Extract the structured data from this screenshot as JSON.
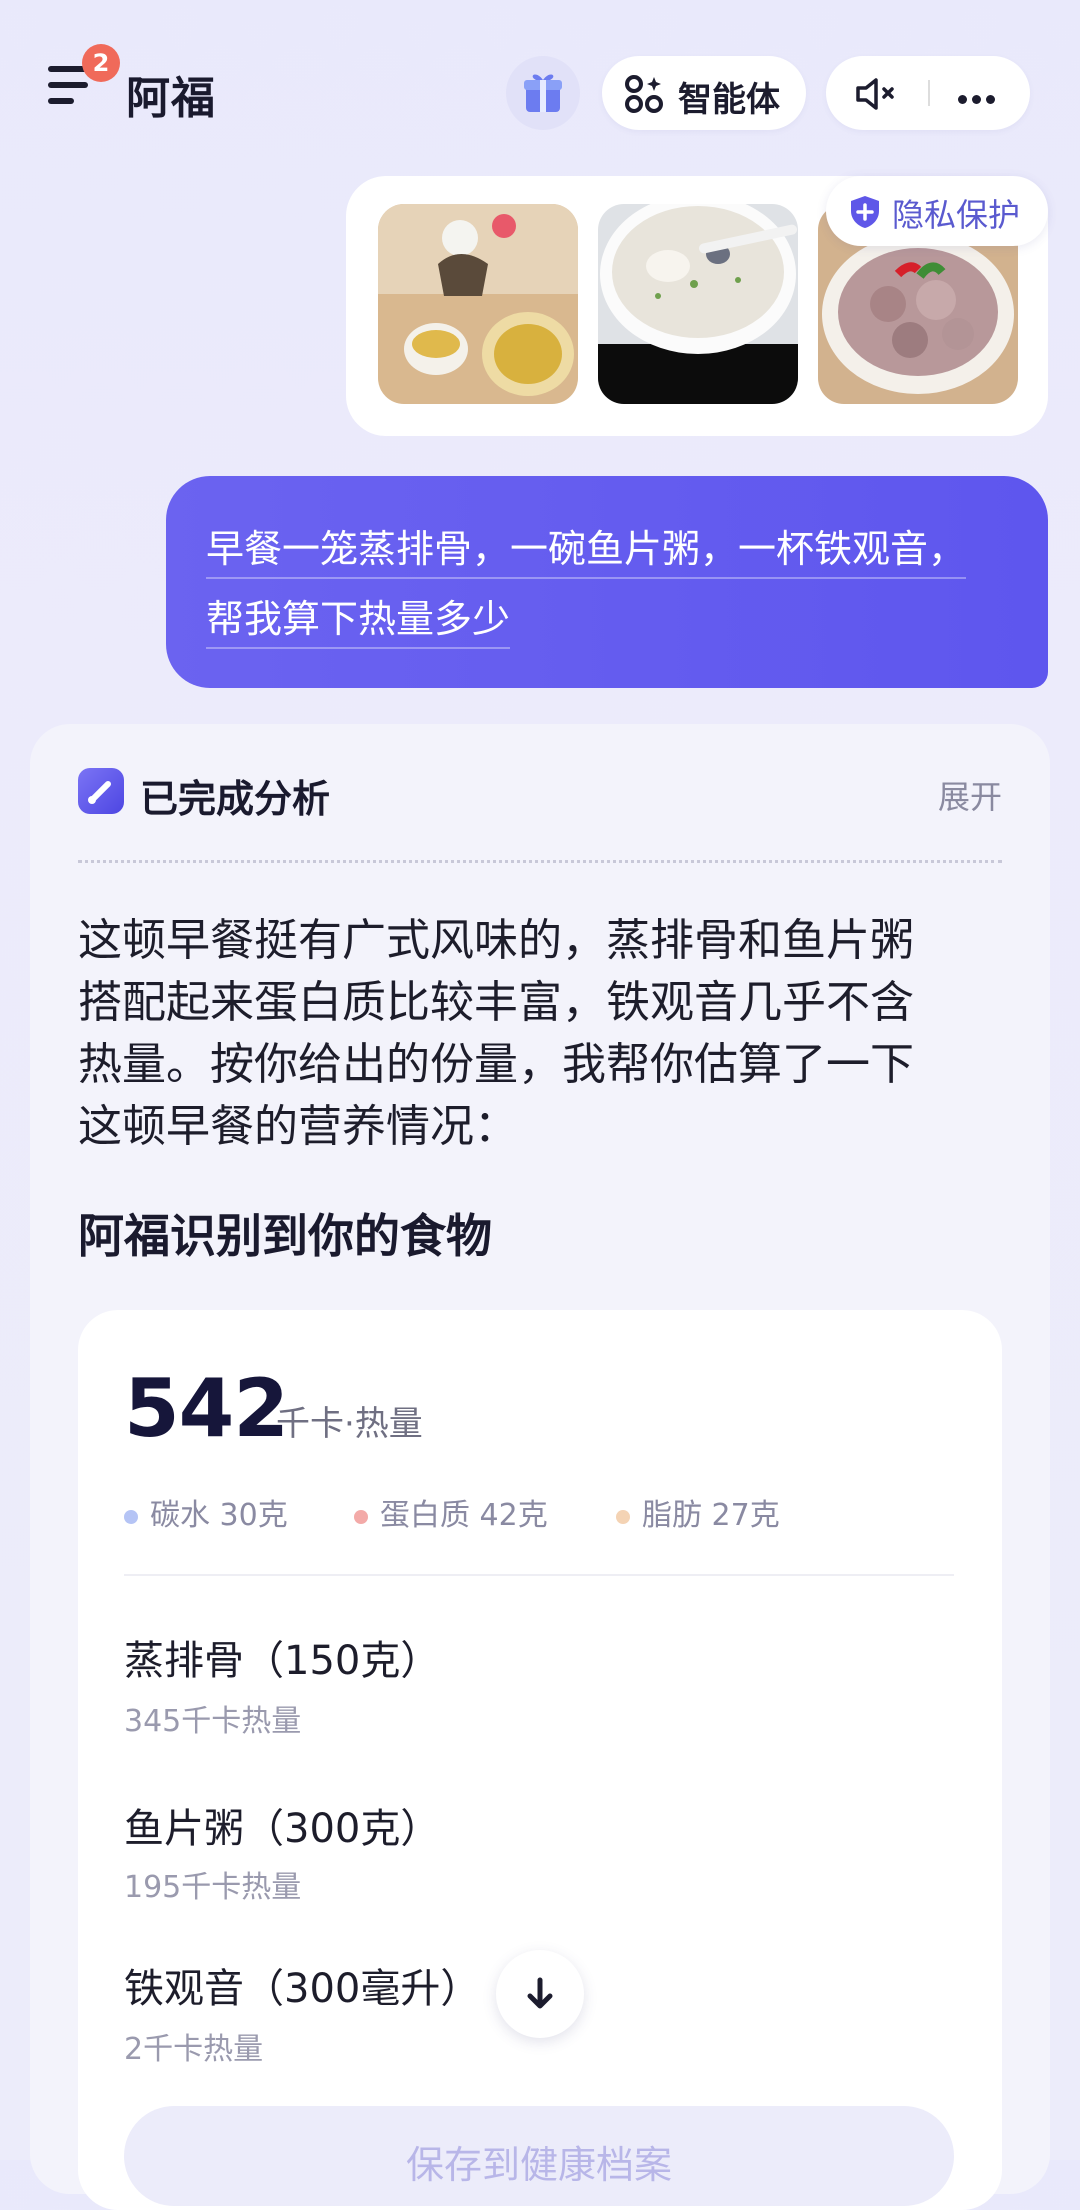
{
  "header": {
    "badge_count": "2",
    "app_name": "阿福",
    "agent_label": "智能体"
  },
  "images": {
    "privacy_label": "隐私保护"
  },
  "user_message": {
    "line1": "早餐一笼蒸排骨，一碗鱼片粥，一杯铁观音，",
    "line2": "帮我算下热量多少"
  },
  "answer": {
    "status": "已完成分析",
    "expand": "展开",
    "paragraph_lines": [
      "这顿早餐挺有广式风味的，蒸排骨和鱼片粥",
      "搭配起来蛋白质比较丰富，铁观音几乎不含",
      "热量。按你给出的份量，我帮你估算了一下",
      "这顿早餐的营养情况："
    ],
    "section_title": "阿福识别到你的食物",
    "total_kcal": "542",
    "kcal_unit": "千卡·热量",
    "macros": [
      {
        "label": "碳水 30克",
        "color": "#b5c4f5"
      },
      {
        "label": "蛋白质 42克",
        "color": "#f3aaa8"
      },
      {
        "label": "脂肪 27克",
        "color": "#f4d3b4"
      }
    ],
    "items": [
      {
        "name": "蒸排骨（150克）",
        "kcal": "345千卡热量"
      },
      {
        "name": "鱼片粥（300克）",
        "kcal": "195千卡热量"
      },
      {
        "name": "铁观音（300毫升）",
        "kcal": "2千卡热量"
      }
    ],
    "save_label": "保存到健康档案"
  }
}
